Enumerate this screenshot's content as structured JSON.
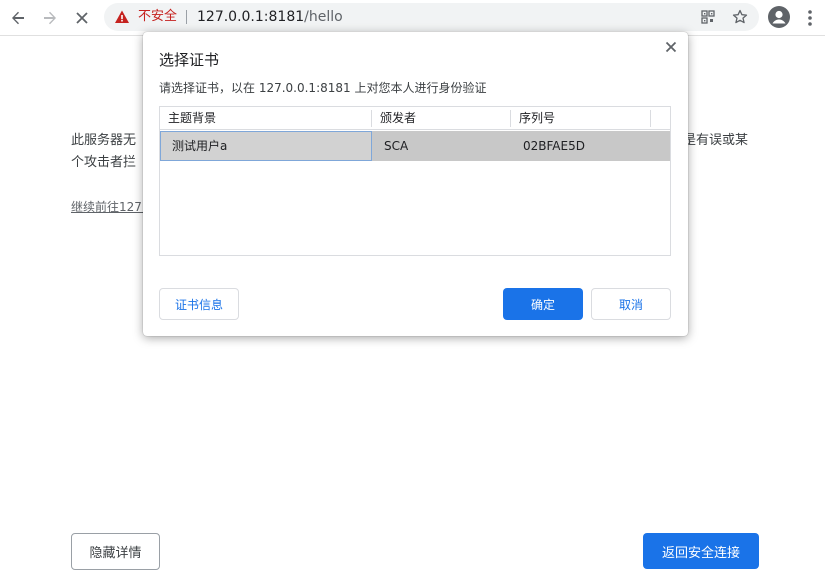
{
  "browser": {
    "security_label": "不安全",
    "url_host": "127.0.0.1:8181",
    "url_path": "/hello"
  },
  "page": {
    "paragraph_left_line1": "此服务器无",
    "paragraph_left_line2": "个攻击者拦",
    "paragraph_right_line1": "是有误或某",
    "continue_link": "继续前往127.",
    "hide_details_label": "隐藏详情",
    "back_to_safety_label": "返回安全连接"
  },
  "dialog": {
    "title": "选择证书",
    "subtitle": "请选择证书，以在 127.0.0.1:8181 上对您本人进行身份验证",
    "columns": [
      "主题背景",
      "颁发者",
      "序列号"
    ],
    "rows": [
      {
        "subject": "测试用户a",
        "issuer": "SCA",
        "serial": "02BFAE5D"
      }
    ],
    "cert_info_label": "证书信息",
    "ok_label": "确定",
    "cancel_label": "取消"
  },
  "colors": {
    "accent": "#1a73e8",
    "insecure": "#c5221f",
    "selected_row": "#c8c8c8"
  }
}
